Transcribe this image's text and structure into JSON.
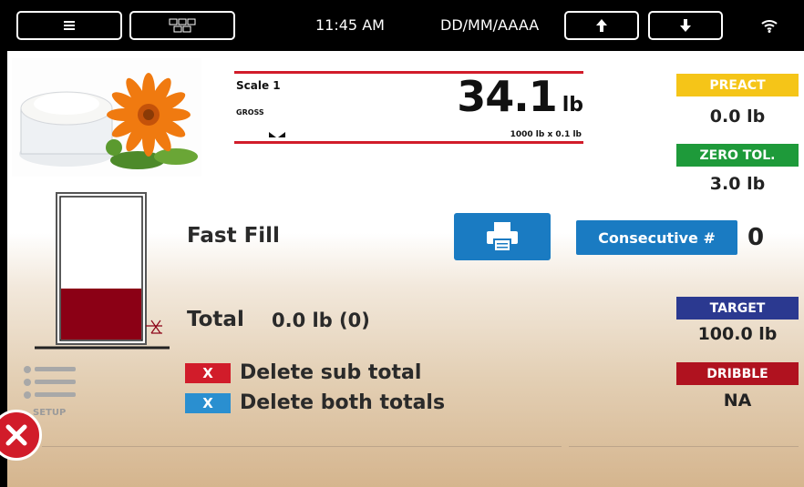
{
  "topbar": {
    "time": "11:45 AM",
    "date_format": "DD/MM/AAAA"
  },
  "scale": {
    "name": "Scale 1",
    "mode": "GROSS",
    "value": "34.1",
    "unit": "lb",
    "capacity": "1000 lb x 0.1 lb"
  },
  "setpoints": {
    "preact": {
      "label": "PREACT",
      "value": "0.0 lb",
      "color": "#f5c518"
    },
    "zero_tol": {
      "label": "ZERO TOL.",
      "value": "3.0 lb",
      "color": "#1e9a3a"
    },
    "target": {
      "label": "TARGET",
      "value": "100.0 lb",
      "color": "#2b3990"
    },
    "dribble": {
      "label": "DRIBBLE",
      "value": "NA",
      "color": "#b0121f"
    }
  },
  "main": {
    "phase": "Fast Fill",
    "consecutive_label": "Consecutive #",
    "consecutive_value": "0",
    "total_label": "Total",
    "total_value": "0.0 lb (0)",
    "fill_level": 0.36
  },
  "actions": {
    "delete_sub_total": {
      "x": "X",
      "label": "Delete sub total"
    },
    "delete_both_totals": {
      "x": "X",
      "label": "Delete both totals"
    }
  },
  "setup_label": "SETUP",
  "icons": [
    "menu-icon",
    "grid-icon",
    "arrow-up-icon",
    "arrow-down-icon",
    "wifi-icon",
    "printer-icon",
    "close-icon",
    "list-icon",
    "product-image"
  ]
}
